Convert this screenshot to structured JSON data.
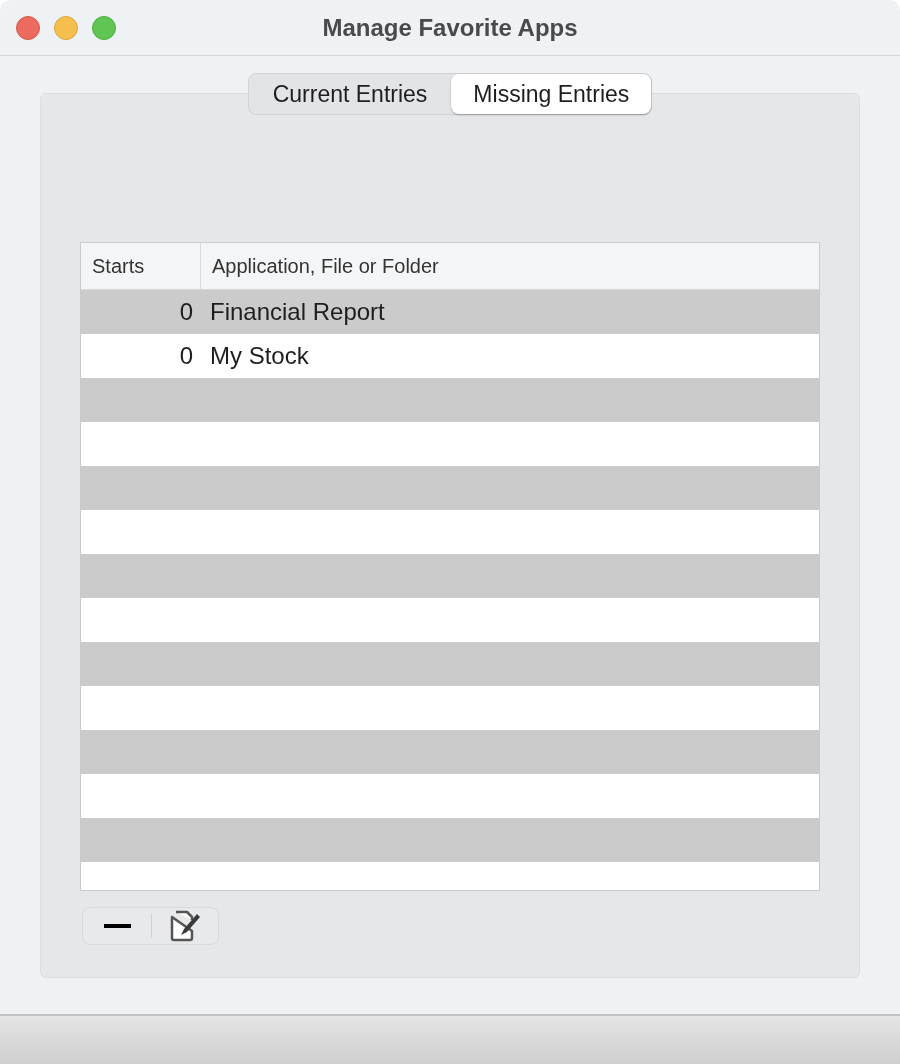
{
  "window": {
    "title": "Manage Favorite Apps"
  },
  "tabs": [
    {
      "label": "Current Entries",
      "selected": false
    },
    {
      "label": "Missing Entries",
      "selected": true
    }
  ],
  "table": {
    "columns": [
      "Starts",
      "Application, File or Folder"
    ],
    "rows": [
      {
        "starts": "0",
        "name": "Financial Report"
      },
      {
        "starts": "0",
        "name": "My Stock"
      }
    ]
  }
}
